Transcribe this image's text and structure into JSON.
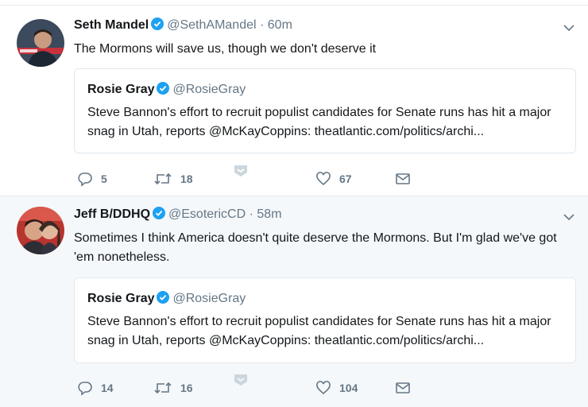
{
  "tweets": [
    {
      "author": "Seth Mandel",
      "handle": "@SethAMandel",
      "dot": "·",
      "time": "60m",
      "text": "The Mormons will save us, though we don't deserve it",
      "quote": {
        "author": "Rosie Gray",
        "handle": "@RosieGray",
        "text": "Steve Bannon's effort to recruit populist candidates for Senate runs has hit a major snag in Utah, reports @McKayCoppins: theatlantic.com/politics/archi..."
      },
      "replies": "5",
      "retweets": "18",
      "likes": "67"
    },
    {
      "author": "Jeff B/DDHQ",
      "handle": "@EsotericCD",
      "dot": "·",
      "time": "58m",
      "text": "Sometimes I think America doesn't quite deserve the Mormons. But I'm glad we've got 'em nonetheless.",
      "quote": {
        "author": "Rosie Gray",
        "handle": "@RosieGray",
        "text": "Steve Bannon's effort to recruit populist candidates for Senate runs has hit a major snag in Utah, reports @McKayCoppins: theatlantic.com/politics/archi..."
      },
      "replies": "14",
      "retweets": "16",
      "likes": "104"
    }
  ],
  "colors": {
    "verified": "#1da1f2",
    "secondary_text": "#657786",
    "border": "#e1e8ed"
  },
  "icons": [
    "verified-badge-icon",
    "chevron-down-icon",
    "reply-icon",
    "retweet-icon",
    "direct-message-icon",
    "heart-icon",
    "mail-icon"
  ]
}
